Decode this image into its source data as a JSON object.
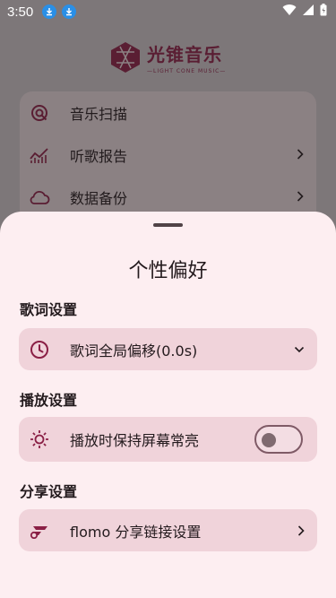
{
  "status_bar": {
    "time": "3:50",
    "notifications": [
      "download-icon",
      "download-icon"
    ],
    "right_icons": [
      "wifi-icon",
      "signal-icon",
      "battery-icon"
    ]
  },
  "background": {
    "logo": {
      "main": "光锥音乐",
      "sub": "—LIGHT CONE MUSIC—"
    },
    "menu": [
      {
        "icon": "scan-icon",
        "label": "音乐扫描",
        "has_chevron": false
      },
      {
        "icon": "chart-icon",
        "label": "听歌报告",
        "has_chevron": true
      },
      {
        "icon": "cloud-icon",
        "label": "数据备份",
        "has_chevron": true
      }
    ]
  },
  "sheet": {
    "title": "个性偏好",
    "sections": [
      {
        "label": "歌词设置",
        "item": {
          "icon": "clock-icon",
          "label": "歌词全局偏移(0.0s)",
          "trail": "dropdown"
        }
      },
      {
        "label": "播放设置",
        "item": {
          "icon": "brightness-icon",
          "label": "播放时保持屏幕常亮",
          "trail": "toggle",
          "toggle_on": false
        }
      },
      {
        "label": "分享设置",
        "item": {
          "icon": "flomo-icon",
          "label": "flomo 分享链接设置",
          "trail": "chevron"
        }
      }
    ]
  },
  "colors": {
    "accent": "#8a1f45",
    "sheet_bg": "#fdeef1",
    "card_bg": "#f0d3da",
    "scrim": "#7d7779"
  }
}
